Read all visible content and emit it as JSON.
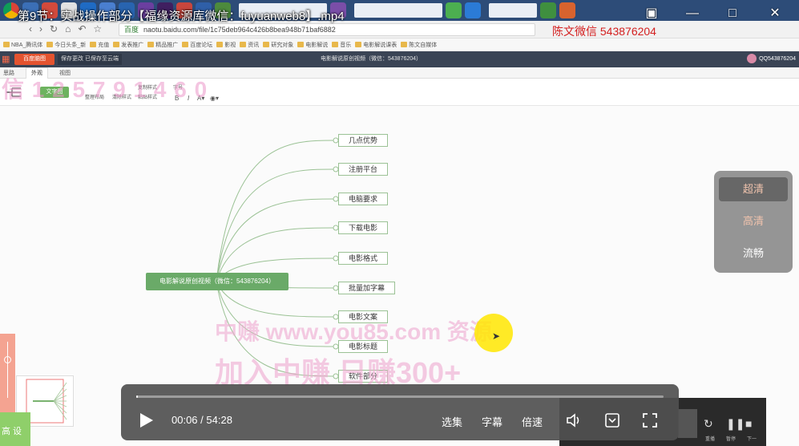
{
  "video": {
    "title": "第9节：实战操作部分【福缘资源库微信：fuyuanweb8】.mp4",
    "time_current": "00:06",
    "time_sep": " / ",
    "time_total": "54:28",
    "progress": 0.002,
    "controls": {
      "episodes": "选集",
      "subtitles": "字幕",
      "speed": "倍速"
    }
  },
  "overlay": {
    "wechat": "陈文微信 543876204"
  },
  "quality": {
    "options": [
      "超清",
      "高清",
      "流畅"
    ],
    "selected": "超清"
  },
  "browser": {
    "url_tag": "百度",
    "url": "naotu.baidu.com/file/1c75deb964c426b8bea948b71baf6882",
    "bookmarks": [
      "NBA_腾讯体",
      "今日头条_新",
      "充值",
      "发表推广",
      "精品推广",
      "百度论坛",
      "影视",
      "资讯",
      "研究对象",
      "电影解说",
      "音乐",
      "电影解说课表",
      "陈文自媒体"
    ]
  },
  "app": {
    "header_btn": "百度脑图",
    "header_note": "保存更改 已保存至云端",
    "doc_title": "电影解说原创视频（微信：543876204）",
    "user": "QQ543876204",
    "tabs": [
      "思路",
      "外观",
      "视图"
    ],
    "active_tab": "外观",
    "toolbar_btn": "文字图",
    "toolbar_labels": [
      "整理布局",
      "清除样式",
      "复制样式",
      "粘贴样式",
      "字号"
    ]
  },
  "mindmap": {
    "root": "电影解说原创视频（微信：543876204）",
    "children": [
      "几点优势",
      "注册平台",
      "电脑要求",
      "下载电影",
      "电影格式",
      "批量加字幕",
      "电影文案",
      "电影标题",
      "软件部分"
    ]
  },
  "watermarks": {
    "left": "信 1 2 5 7 9 1 4 6 0",
    "line1": "中赚 www.you85.com 资源",
    "line2": "加入中赚 日赚300+"
  },
  "corner": "高 设",
  "mini_player": {
    "labels": [
      "重播",
      "暂停",
      "下一"
    ]
  }
}
